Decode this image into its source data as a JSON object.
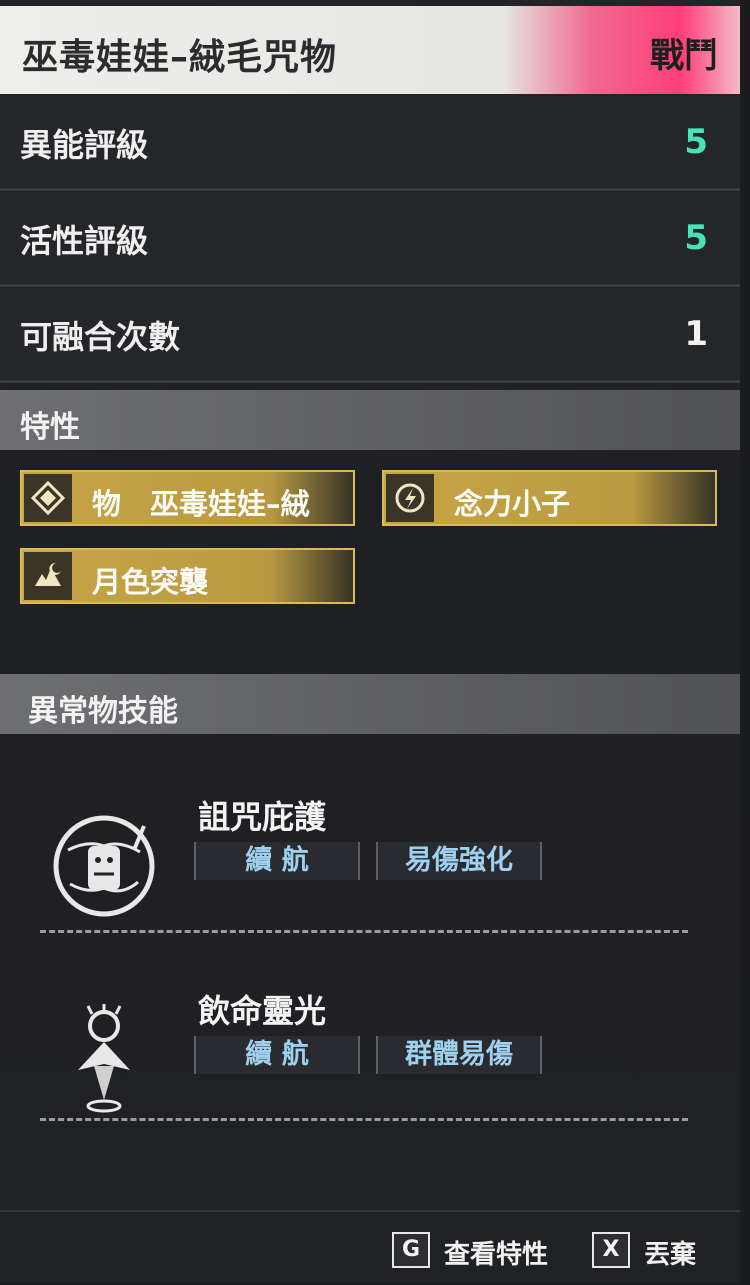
{
  "header": {
    "title": "巫毒娃娃–絨毛咒物",
    "tag": "戰鬥"
  },
  "stats": [
    {
      "label": "異能評級",
      "value": "5"
    },
    {
      "label": "活性評級",
      "value": "5"
    },
    {
      "label": "可融合次數",
      "value": "1"
    }
  ],
  "traits_section": {
    "label": "特性",
    "items": [
      {
        "label": "物　巫毒娃娃–絨",
        "icon": "diamond-icon"
      },
      {
        "label": "念力小子",
        "icon": "psi-target-icon"
      },
      {
        "label": "月色突襲",
        "icon": "moon-strike-icon"
      }
    ]
  },
  "skills_section": {
    "label": "異常物技能",
    "skills": [
      {
        "name": "詛咒庇護",
        "tags": [
          "續 航",
          "易傷強化"
        ],
        "icon": "voodoo-emblem-icon"
      },
      {
        "name": "飲命靈光",
        "tags": [
          "續 航",
          "群體易傷"
        ],
        "icon": "doll-figure-icon"
      }
    ]
  },
  "footer": {
    "actions": [
      {
        "key": "G",
        "label": "查看特性"
      },
      {
        "key": "X",
        "label": "丟棄"
      }
    ]
  },
  "colors": {
    "accent_value": "#46e2b8",
    "trait_gold": "#c7a546",
    "tag_text": "#9fd0ee",
    "header_pink": "#ff3d7a"
  }
}
